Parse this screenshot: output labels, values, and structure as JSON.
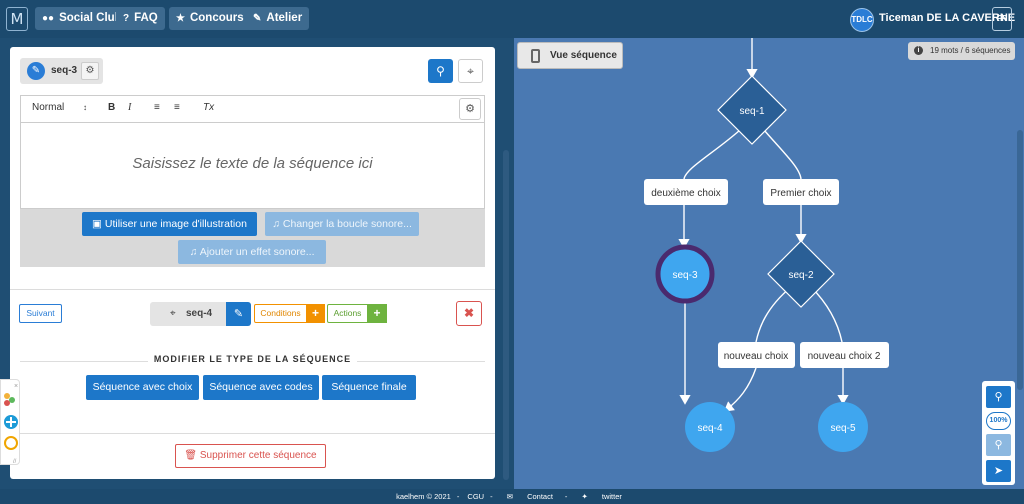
{
  "nav": {
    "logo": "M",
    "buttons": [
      {
        "label": "Social Club",
        "icon": "users-icon"
      },
      {
        "label": "FAQ",
        "icon": "question-icon"
      },
      {
        "label": "Concours",
        "icon": "trophy-icon"
      },
      {
        "label": "Atelier",
        "icon": "pencil-icon"
      }
    ],
    "user_initials": "TDLC",
    "user_name": "Ticeman DE LA CAVERNE",
    "lang": "FR"
  },
  "editor": {
    "seq_name": "seq-3",
    "toolbar": {
      "format": "Normal",
      "bold": "B",
      "italic": "I",
      "clear": "Tx"
    },
    "placeholder": "Saisissez le texte de la séquence ici",
    "media_buttons": {
      "illustration": "Utiliser une image d'illustration",
      "loop_sound": "Changer la boucle sonore...",
      "sound_effect": "Ajouter un effet sonore..."
    },
    "next_label": "Suivant",
    "next_seq": "seq-4",
    "conditions": "Conditions",
    "actions": "Actions",
    "type_heading": "MODIFIER LE TYPE DE LA SÉQUENCE",
    "type_buttons": [
      "Séquence avec choix",
      "Séquence avec codes",
      "Séquence finale"
    ],
    "delete_label": "Supprimer cette séquence"
  },
  "graph": {
    "view_label": "Vue séquence",
    "stats": "19 mots / 6 séquences",
    "zoom_label": "100%",
    "nodes": {
      "seq1": "seq-1",
      "seq2": "seq-2",
      "seq3": "seq-3",
      "seq4": "seq-4",
      "seq5": "seq-5"
    },
    "edges": {
      "deuxieme": "deuxième choix",
      "premier": "Premier choix",
      "nouveau": "nouveau choix",
      "nouveau2": "nouveau choix 2"
    }
  },
  "footer": {
    "copyright": "kaelhem © 2021",
    "cgu": "CGU",
    "contact": "Contact",
    "twitter": "twitter"
  },
  "colors": {
    "primary": "#1d77c9",
    "graph_bg": "#4a79b2",
    "diamond": "#2a5f96",
    "circle": "#3fa6ef",
    "selected_ring": "#4a2a6e"
  }
}
